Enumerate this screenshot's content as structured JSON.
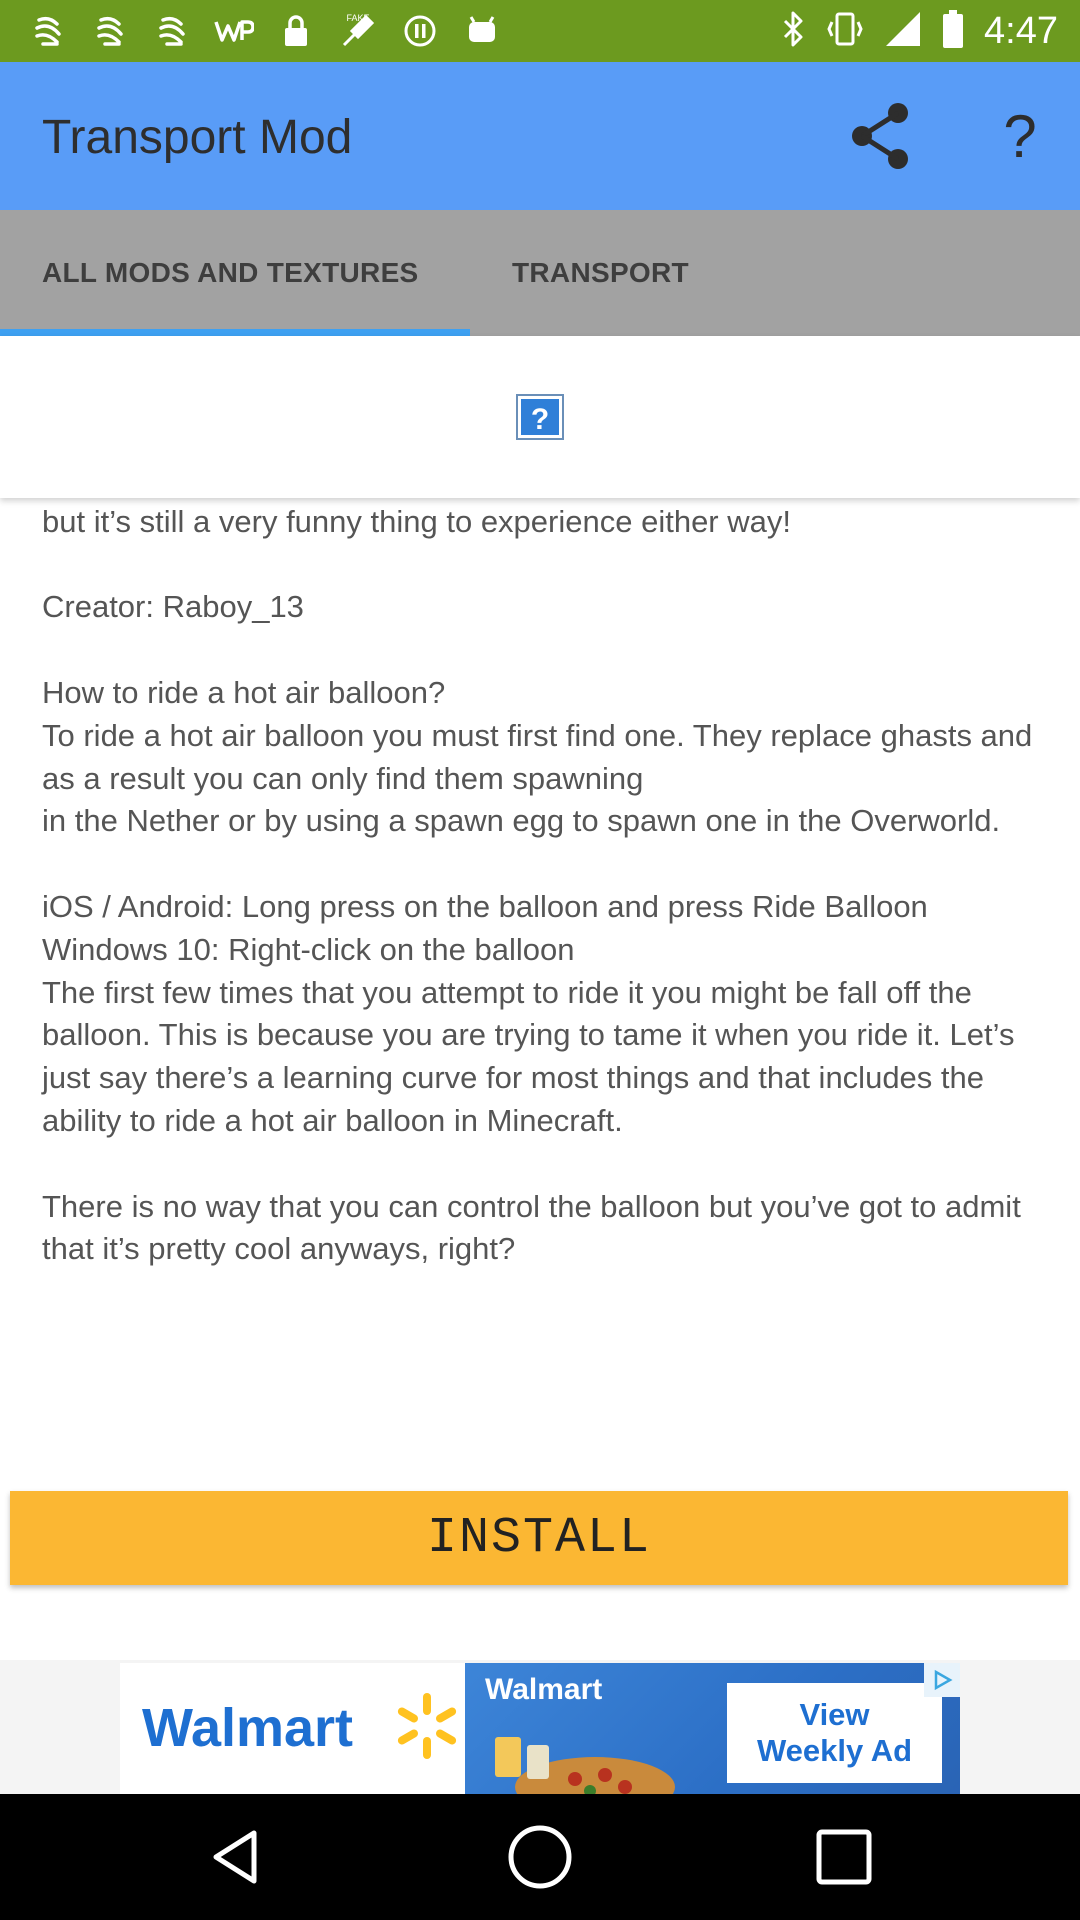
{
  "status_bar": {
    "time": "4:47",
    "left_icons": [
      "notification-icon",
      "notification-icon",
      "notification-icon",
      "wp-icon",
      "lock-icon",
      "fake-gps-icon",
      "pause-circle-icon",
      "android-icon"
    ],
    "right_icons": [
      "bluetooth-icon",
      "vibrate-icon",
      "signal-icon",
      "battery-icon"
    ]
  },
  "app_bar": {
    "title": "Transport Mod",
    "share_icon": "share-icon",
    "help_label": "?"
  },
  "tabs": [
    {
      "label": "ALL MODS AND TEXTURES",
      "selected": true
    },
    {
      "label": "TRANSPORT",
      "selected": false
    }
  ],
  "content": {
    "image_icon": "broken-image-icon",
    "body_text": "game. The only downside I could find is the fact that you can’t control it but it’s still a very funny thing to experience either way!\n\nCreator: Raboy_13\n\nHow to ride a hot air balloon?\nTo ride a hot air balloon you must first find one. They replace ghasts and as a result you can only find them spawning\nin the Nether or by using a spawn egg to spawn one in the Overworld.\n\niOS / Android: Long press on the balloon and press Ride Balloon\nWindows 10: Right-click on the balloon\nThe first few times that you attempt to ride it you might be fall off the balloon. This is because you are trying to tame it when you ride it. Let’s just say there’s a learning curve for most things and that includes the ability to ride a hot air balloon in Minecraft.\n\nThere is no way that you can control the balloon but you’ve got to admit that it’s pretty cool anyways, right?"
  },
  "install_button": {
    "label": "INSTALL",
    "color": "#fbb733"
  },
  "ad": {
    "brand": "Walmart",
    "photo_brand": "Walmart",
    "cta_line1": "View",
    "cta_line2": "Weekly Ad",
    "brand_color": "#1e6fd1",
    "spark_color": "#ffc220"
  },
  "colors": {
    "status_bar": "#6c9a1f",
    "app_bar": "#599cf7",
    "tab_bar": "#a2a2a2",
    "tab_indicator": "#3ea0f1"
  },
  "nav_bar": {
    "icons": [
      "back-icon",
      "home-icon",
      "recent-apps-icon"
    ]
  }
}
